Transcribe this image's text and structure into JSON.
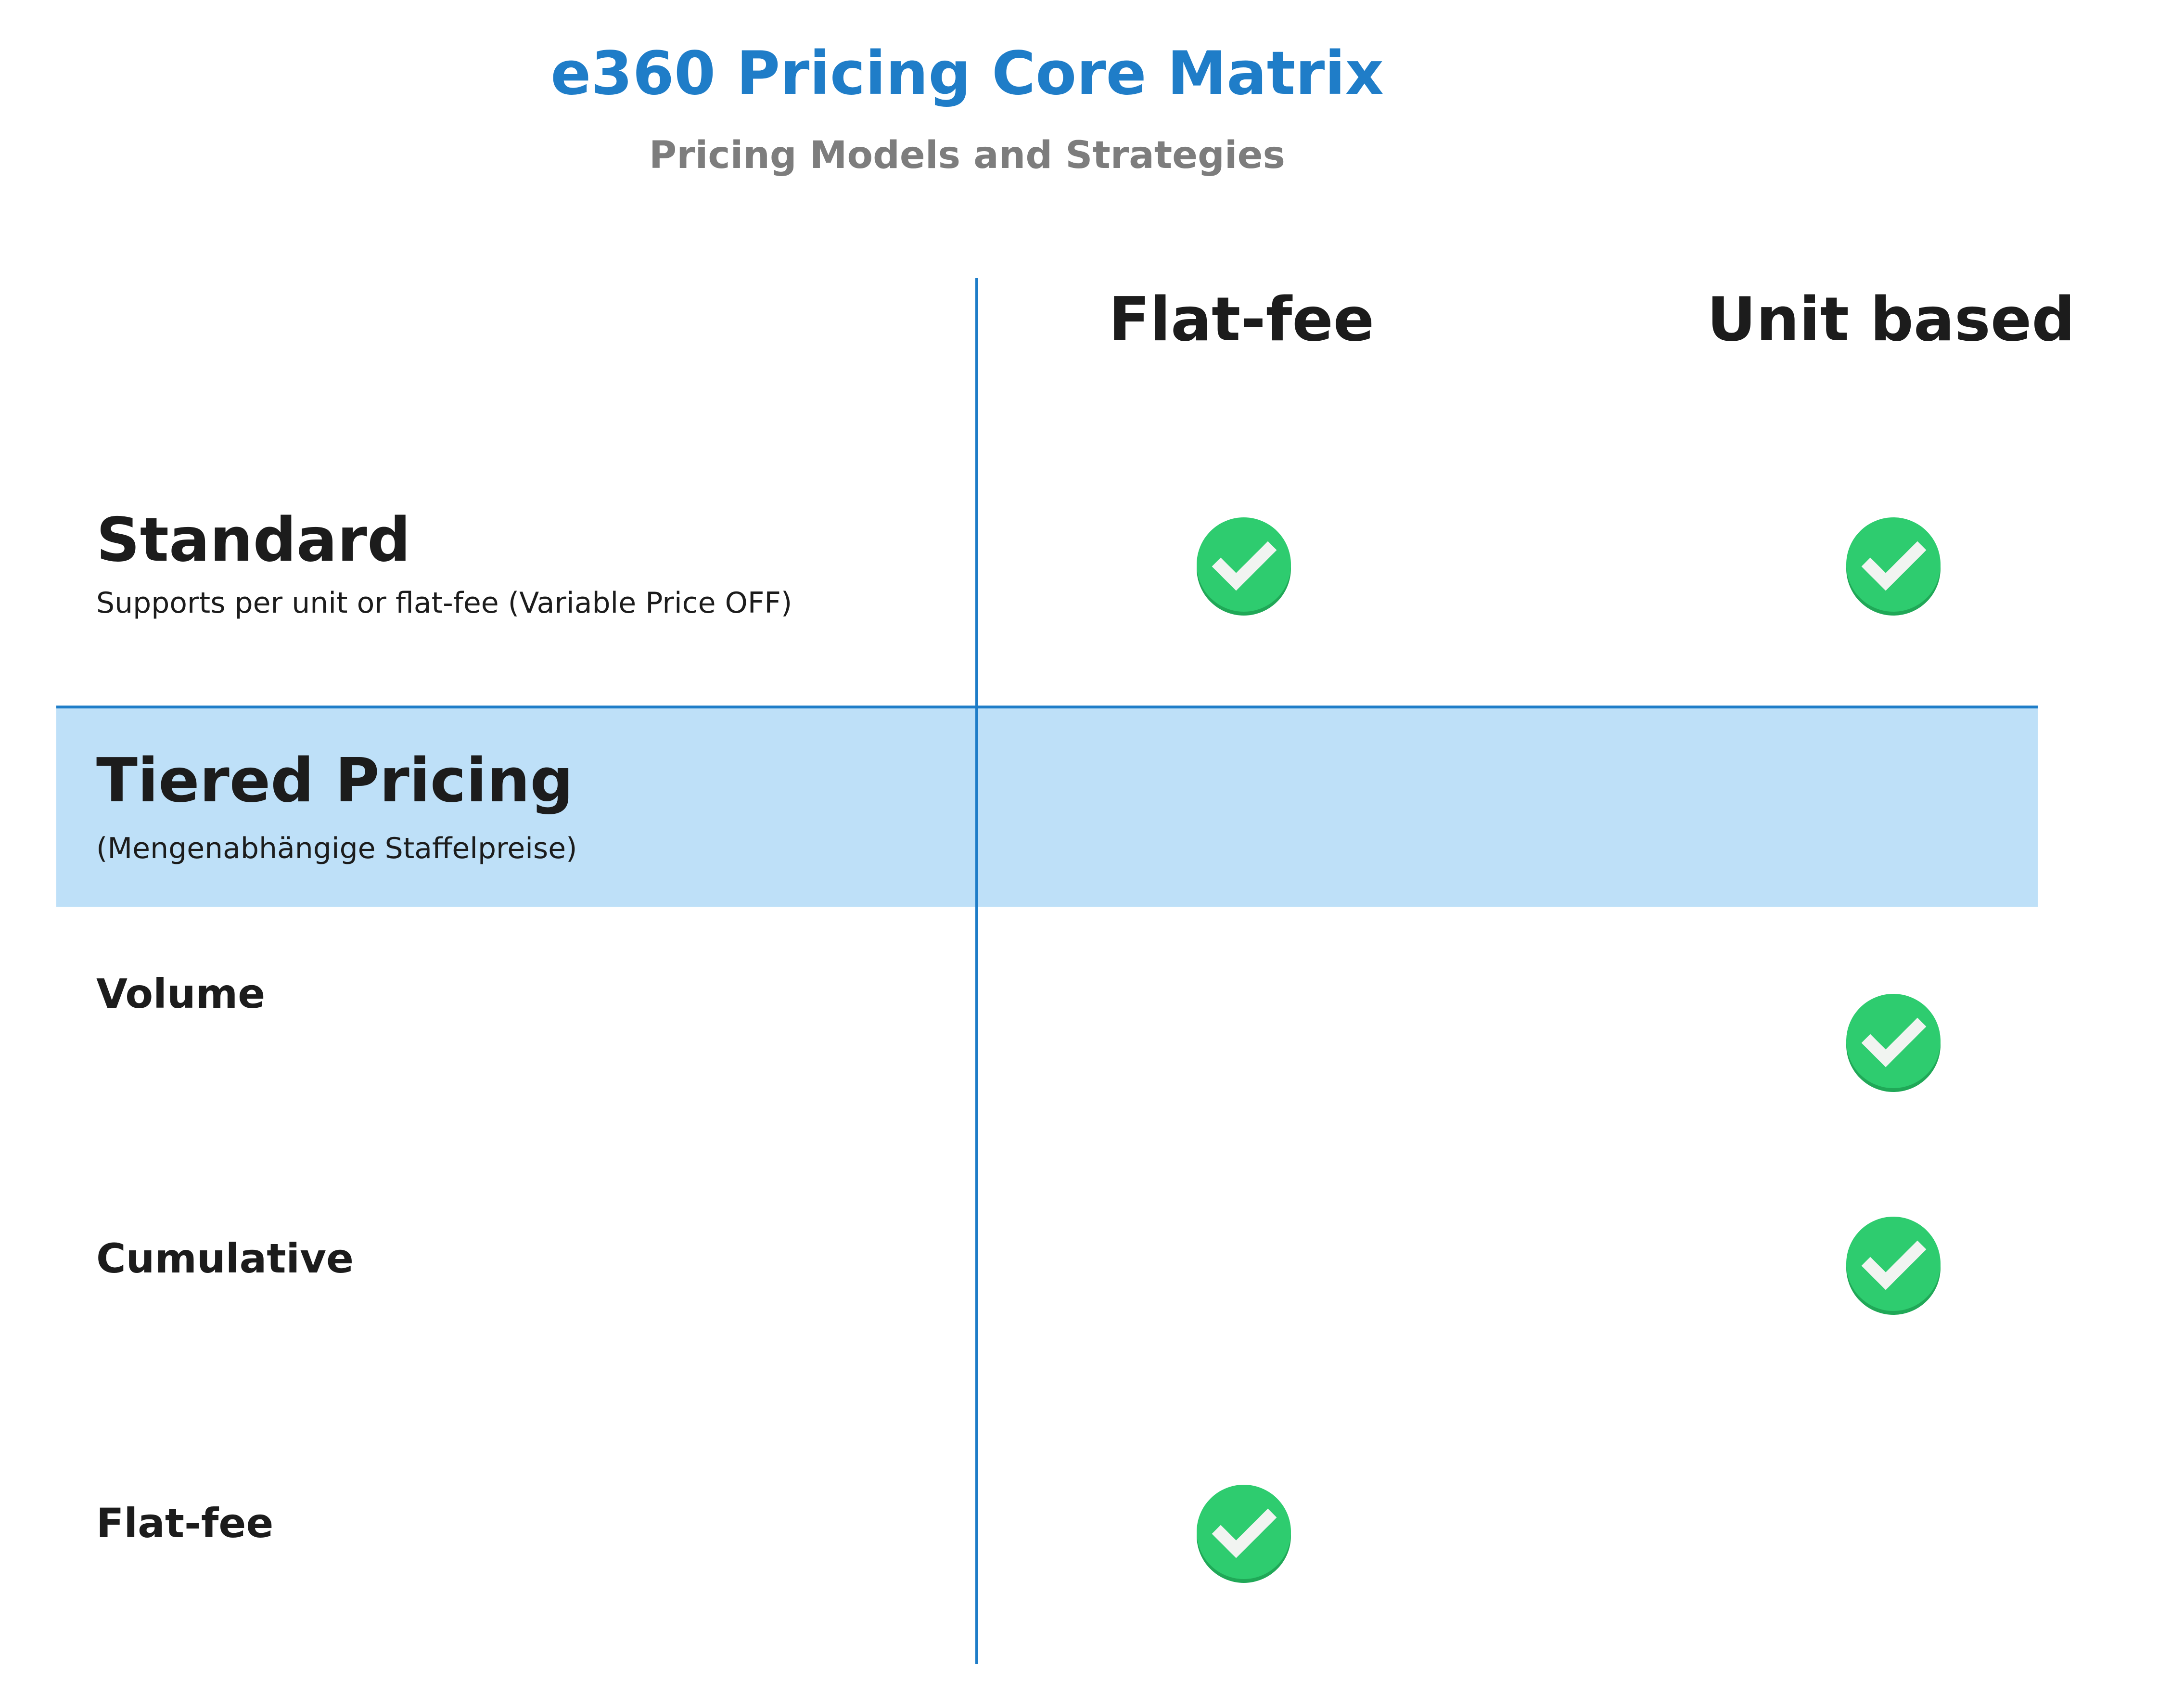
{
  "title": "e360 Pricing Core Matrix",
  "subtitle": "Pricing Models and Strategies",
  "columns": [
    "Flat-fee",
    "Unit based"
  ],
  "rows": [
    {
      "name": "Standard",
      "description": "Supports per unit or flat-fee (Variable Price OFF)",
      "checks": {
        "flat_fee": true,
        "unit_based": true
      }
    },
    {
      "name": "Tiered Pricing",
      "description": "(Mengenabhängige Staffelpreise)",
      "section_header": true
    },
    {
      "name": "Volume",
      "checks": {
        "flat_fee": false,
        "unit_based": true
      }
    },
    {
      "name": "Cumulative",
      "checks": {
        "flat_fee": false,
        "unit_based": true
      }
    },
    {
      "name": "Flat-fee",
      "checks": {
        "flat_fee": true,
        "unit_based": false
      }
    }
  ],
  "colors": {
    "title": "#1f7dc8",
    "subtitle": "#7d7d7d",
    "grid_line": "#1f7dc8",
    "section_band": "#bee0f8",
    "check_fill": "#2ecc6f",
    "check_shadow": "#20a857"
  },
  "icons": {
    "check": "check-circle-icon"
  }
}
